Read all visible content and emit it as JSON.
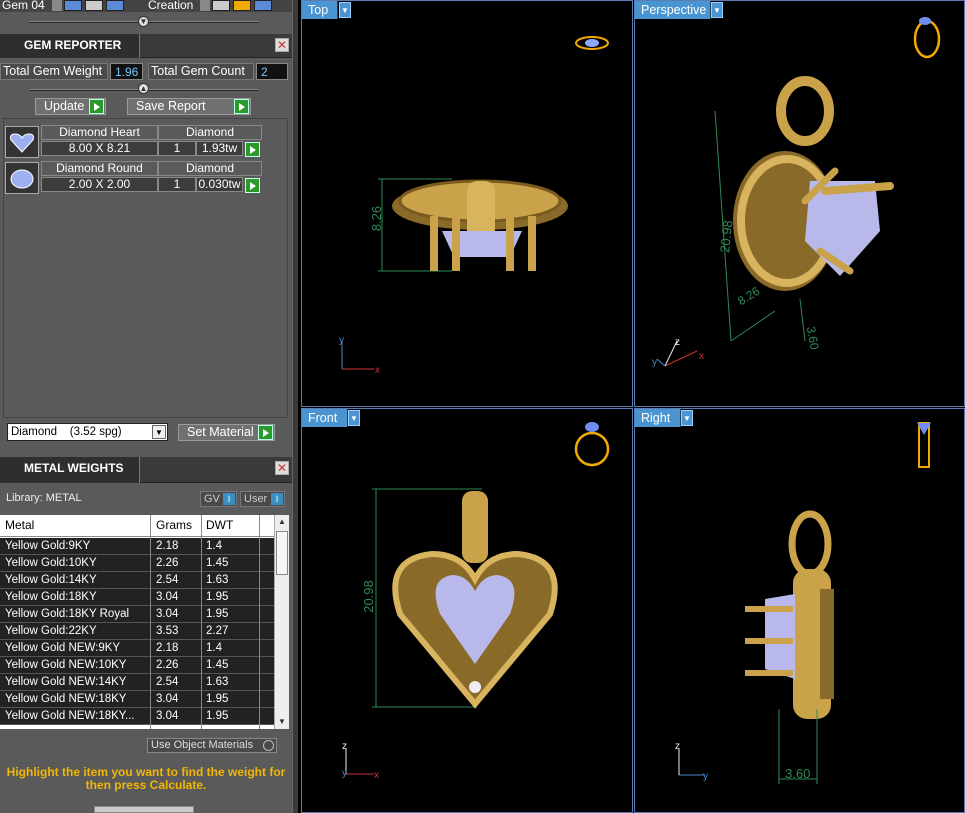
{
  "toolbar": {
    "gem_label": "Gem 04",
    "creation_label": "Creation"
  },
  "gem_reporter": {
    "title": "GEM REPORTER",
    "total_weight_label": "Total Gem Weight",
    "total_weight_value": "1.96",
    "total_count_label": "Total Gem Count",
    "total_count_value": "2",
    "update_label": "Update",
    "save_label": "Save Report",
    "gems": [
      {
        "name": "Diamond Heart",
        "material": "Diamond",
        "size": "8.00 X 8.21",
        "qty": "1",
        "weight": "1.93tw"
      },
      {
        "name": "Diamond Round",
        "material": "Diamond",
        "size": "2.00 X 2.00",
        "qty": "1",
        "weight": "0.030tw"
      }
    ],
    "material_select": "Diamond    (3.52 spg)",
    "set_material_label": "Set Material"
  },
  "metal_weights": {
    "title": "METAL WEIGHTS",
    "library_label": "Library: METAL",
    "gv_label": "GV",
    "user_label": "User",
    "columns": [
      "Metal",
      "Grams",
      "DWT"
    ],
    "rows": [
      [
        "Yellow Gold:9KY",
        "2.18",
        "1.4"
      ],
      [
        "Yellow Gold:10KY",
        "2.26",
        "1.45"
      ],
      [
        "Yellow Gold:14KY",
        "2.54",
        "1.63"
      ],
      [
        "Yellow Gold:18KY",
        "3.04",
        "1.95"
      ],
      [
        "Yellow Gold:18KY Royal",
        "3.04",
        "1.95"
      ],
      [
        "Yellow Gold:22KY",
        "3.53",
        "2.27"
      ],
      [
        "Yellow Gold NEW:9KY",
        "2.18",
        "1.4"
      ],
      [
        "Yellow Gold NEW:10KY",
        "2.26",
        "1.45"
      ],
      [
        "Yellow Gold NEW:14KY",
        "2.54",
        "1.63"
      ],
      [
        "Yellow Gold NEW:18KY",
        "3.04",
        "1.95"
      ],
      [
        "Yellow Gold NEW:18KY...",
        "3.04",
        "1.95"
      ]
    ],
    "use_object_label": "Use Object Materials",
    "hint": "Highlight the item you want to find the weight for then press Calculate."
  },
  "viewports": {
    "top": {
      "title": "Top",
      "dim1": "8.26"
    },
    "perspective": {
      "title": "Perspective",
      "dim1": "20.98",
      "dim2": "8.26",
      "dim3": "3.60"
    },
    "front": {
      "title": "Front",
      "dim1": "20.98"
    },
    "right": {
      "title": "Right",
      "dim1": "3.60"
    }
  },
  "colors": {
    "viewport_title": "#4a94d2",
    "gold": "#c9a24a",
    "gem": "#b8b8ea",
    "dimension": "#2e8a55",
    "hint": "#f2b705"
  }
}
